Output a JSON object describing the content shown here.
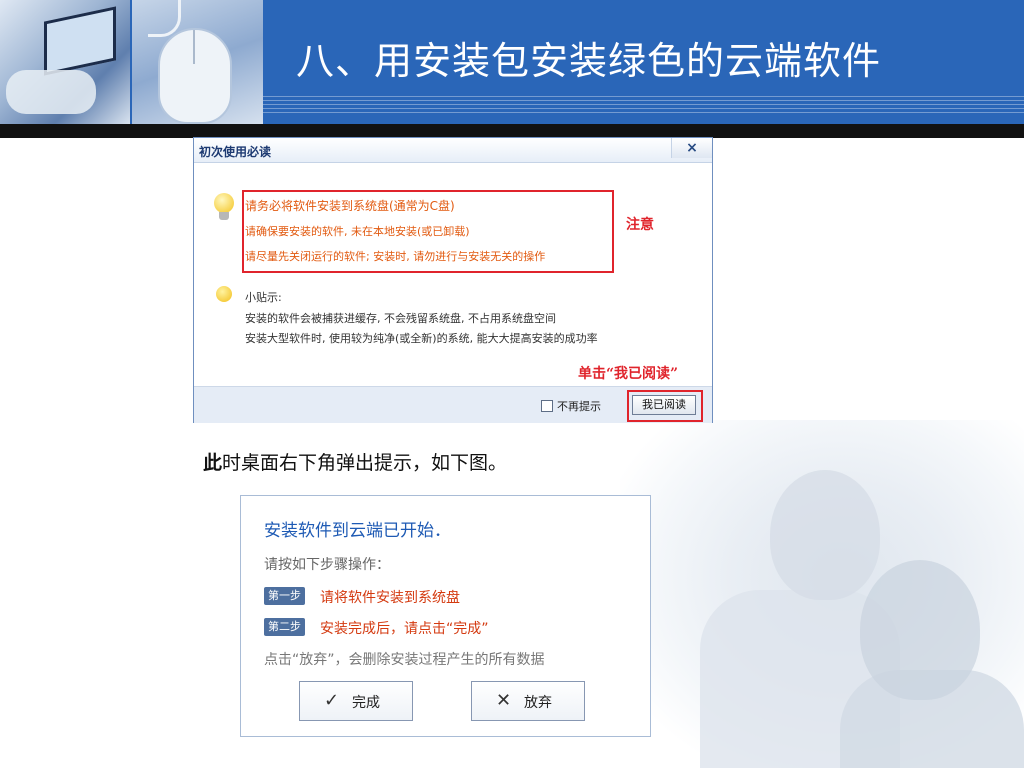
{
  "slide": {
    "title": "八、用安装包安装绿色的云端软件"
  },
  "dialog": {
    "title": "初次使用必读",
    "close_label": "×",
    "warnings": [
      "请务必将软件安装到系统盘(通常为C盘)",
      "请确保要安装的软件, 未在本地安装(或已卸载)",
      "请尽量先关闭运行的软件; 安装时, 请勿进行与安装无关的操作"
    ],
    "warning_annotation": "注意",
    "tips_heading": "小贴示:",
    "tips": [
      "安装的软件会被捕获进缓存, 不会残留系统盘, 不占用系统盘空间",
      "安装大型软件时, 使用较为纯净(或全新)的系统, 能大大提高安装的成功率"
    ],
    "click_annotation": "单击“我已阅读”",
    "checkbox_label": "不再提示",
    "read_button": "我已阅读"
  },
  "caption": {
    "bold": "此",
    "rest": "时桌面右下角弹出提示，如下图。"
  },
  "toast": {
    "title": "安装软件到云端已开始．",
    "subtitle": "请按如下步骤操作：",
    "steps": [
      {
        "badge": "第一步",
        "text": "请将软件安装到系统盘"
      },
      {
        "badge": "第二步",
        "text": "安装完成后，请点击“完成”"
      }
    ],
    "note": "点击“放弃”，会删除安装过程产生的所有数据",
    "finish_button": "完成",
    "finish_icon": "✓",
    "abandon_button": "放弃",
    "abandon_icon": "✕"
  },
  "colors": {
    "header_blue": "#2a66b8",
    "warning_red": "#e0242c",
    "warning_orange": "#e25a10",
    "toast_title_blue": "#1e5ab4",
    "step_red": "#d43a10"
  }
}
